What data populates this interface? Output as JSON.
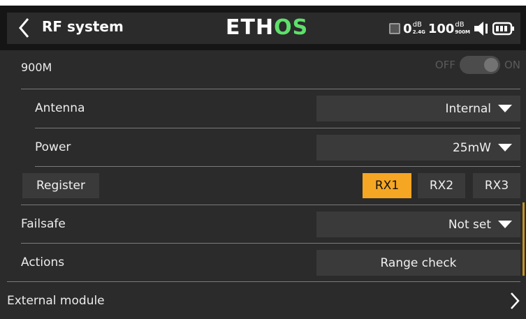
{
  "header": {
    "title": "RF system",
    "logo_main": "ETH",
    "logo_accent": "OS",
    "rssi_24": "0",
    "rssi_24_unit": "dB",
    "rssi_24_band": "2.4G",
    "rssi_900": "100",
    "rssi_900_unit": "dB",
    "rssi_900_band": "900M"
  },
  "module900": {
    "label": "900M",
    "toggle_off": "OFF",
    "toggle_on": "ON"
  },
  "antenna": {
    "label": "Antenna",
    "value": "Internal"
  },
  "power": {
    "label": "Power",
    "value": "25mW"
  },
  "register": {
    "label": "Register",
    "receivers": [
      "RX1",
      "RX2",
      "RX3"
    ],
    "active": "RX1"
  },
  "failsafe": {
    "label": "Failsafe",
    "value": "Not set"
  },
  "actions": {
    "label": "Actions",
    "button": "Range check"
  },
  "external": {
    "label": "External module"
  },
  "colors": {
    "accent": "#f5a623",
    "logo_green": "#5ee06b",
    "background": "#2b2b2b"
  }
}
